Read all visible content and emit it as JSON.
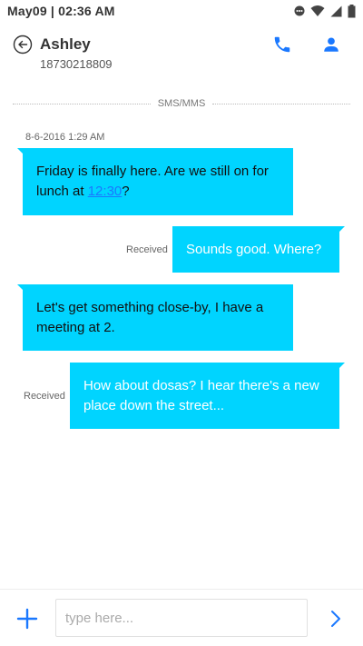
{
  "status_bar": {
    "time": "May09 | 02:36 AM",
    "icons": [
      "notification-dot-icon",
      "wifi-icon",
      "signal-icon",
      "battery-icon"
    ]
  },
  "header": {
    "contact_name": "Ashley",
    "contact_number": "18730218809",
    "back_icon": "back-arrow-icon",
    "call_icon": "phone-icon",
    "contact_icon": "person-icon"
  },
  "conversation": {
    "channel_label": "SMS/MMS",
    "timestamp": "8-6-2016 1:29 AM",
    "messages": [
      {
        "direction": "incoming",
        "text_before_link": "Friday is finally here. Are we still on for lunch at ",
        "link": "12:30",
        "text_after_link": "?"
      },
      {
        "direction": "outgoing",
        "status": "Received",
        "text": "Sounds good. Where?"
      },
      {
        "direction": "incoming",
        "text": "Let's get something close-by, I have a meeting at 2."
      },
      {
        "direction": "outgoing",
        "status": "Received",
        "text": "How about dosas? I hear there's a new place down the street..."
      }
    ]
  },
  "compose": {
    "placeholder": "type here...",
    "value": "",
    "add_icon": "plus-icon",
    "send_icon": "send-chevron-icon"
  },
  "colors": {
    "bubble": "#00d4ff",
    "accent": "#1a78ff"
  }
}
